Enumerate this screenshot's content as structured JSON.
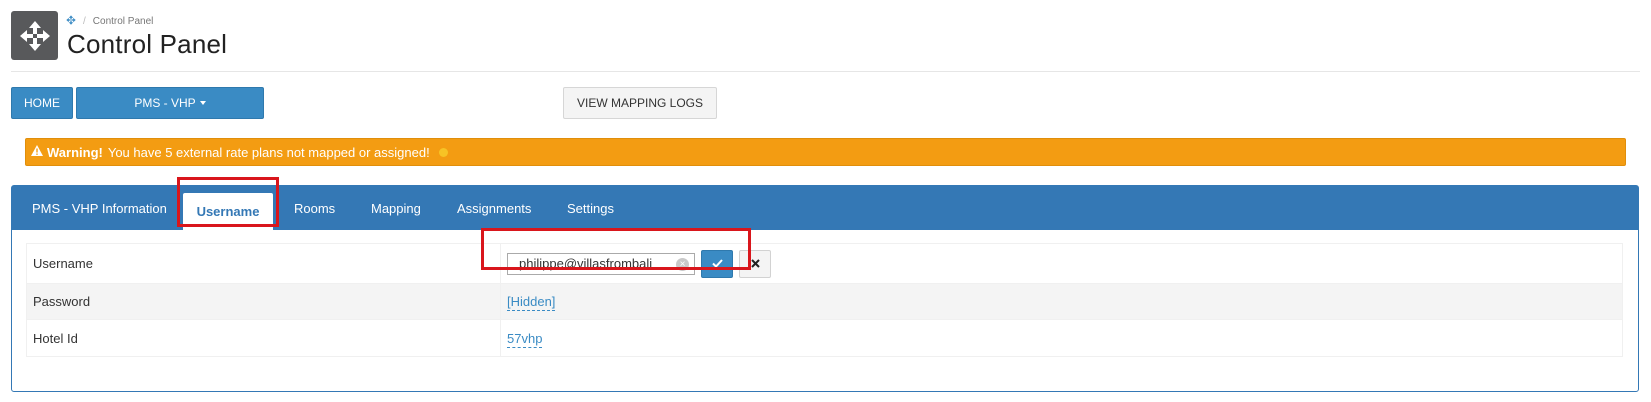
{
  "header": {
    "breadcrumb": {
      "current": "Control Panel"
    },
    "title": "Control Panel"
  },
  "toolbar": {
    "home_label": "HOME",
    "pms_label": "PMS - VHP",
    "view_logs_label": "VIEW MAPPING LOGS"
  },
  "warning": {
    "strong": "Warning!",
    "message": "You have 5 external rate plans not mapped or assigned!"
  },
  "tabs": [
    {
      "label": "PMS - VHP Information"
    },
    {
      "label": "Username"
    },
    {
      "label": "Rooms"
    },
    {
      "label": "Mapping"
    },
    {
      "label": "Assignments"
    },
    {
      "label": "Settings"
    }
  ],
  "info": {
    "username": {
      "label": "Username",
      "value": "philippe@villasfrombali"
    },
    "password": {
      "label": "Password",
      "value": "[Hidden]"
    },
    "hotel_id": {
      "label": "Hotel Id",
      "value": "57vhp"
    }
  },
  "colors": {
    "primary": "#3478b5",
    "button": "#3a8bc4",
    "warning": "#f39c12",
    "highlight": "#d9161c"
  }
}
